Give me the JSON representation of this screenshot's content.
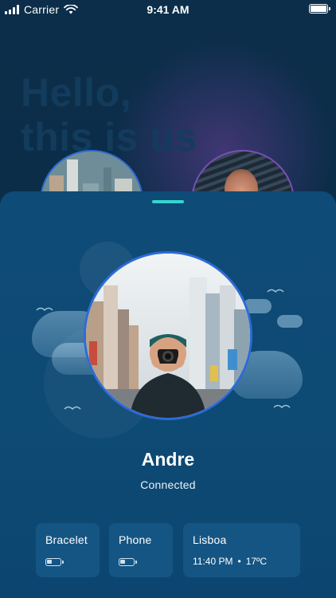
{
  "status_bar": {
    "carrier": "Carrier",
    "time": "9:41 AM",
    "battery_level": 1.0
  },
  "background": {
    "headline_line1": "Hello,",
    "headline_line2": "this is us"
  },
  "profile": {
    "name": "Andre",
    "status": "Connected"
  },
  "cards": {
    "bracelet": {
      "label": "Bracelet",
      "battery_level": 0.4
    },
    "phone": {
      "label": "Phone",
      "battery_level": 0.4
    },
    "location": {
      "label": "Lisboa",
      "time": "11:40 PM",
      "separator": "•",
      "temperature": "17ºC"
    }
  },
  "colors": {
    "accent_grabber": "#35d6d0",
    "sheet_bg": "#0d4a74",
    "card_bg": "#155583",
    "avatar_ring": "#2d6bd6",
    "page_bg": "#0b2f4c"
  },
  "icons": {
    "signal": "signal-icon",
    "wifi": "wifi-icon",
    "battery": "battery-icon",
    "card_battery": "battery-low-icon"
  }
}
